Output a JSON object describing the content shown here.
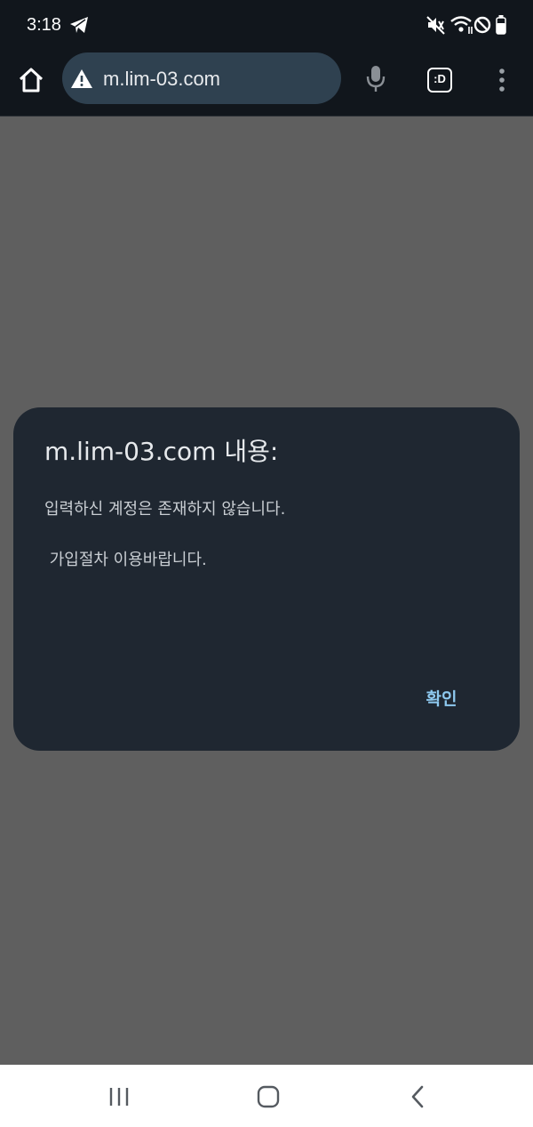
{
  "status_bar": {
    "time": "3:18",
    "icons": [
      "telegram-icon",
      "mute-vibrate-icon",
      "wifi-icon",
      "do-not-disturb-icon",
      "battery-icon"
    ]
  },
  "browser": {
    "url": "m.lim-03.com",
    "security_icon": "warning-triangle-icon",
    "toolbar_icons": [
      "home-icon",
      "mic-icon",
      "tab-switcher-icon",
      "more-vert-icon"
    ],
    "tab_switcher_label": ":D"
  },
  "dialog": {
    "title": "m.lim-03.com 내용:",
    "message_line_1": "입력하신 계정은 존재하지 않습니다.",
    "message_line_2": " 가입절차 이용바랍니다.",
    "ok_label": "확인",
    "accent_color": "#8ec9ef"
  },
  "nav_bar": {
    "buttons": [
      "recent-apps-icon",
      "home-button-icon",
      "back-icon"
    ]
  },
  "colors": {
    "bar_background": "#11161c",
    "omnibox": "#2f4150",
    "overlay_background": "#5f5f5f",
    "dialog_background": "#1f2731"
  }
}
